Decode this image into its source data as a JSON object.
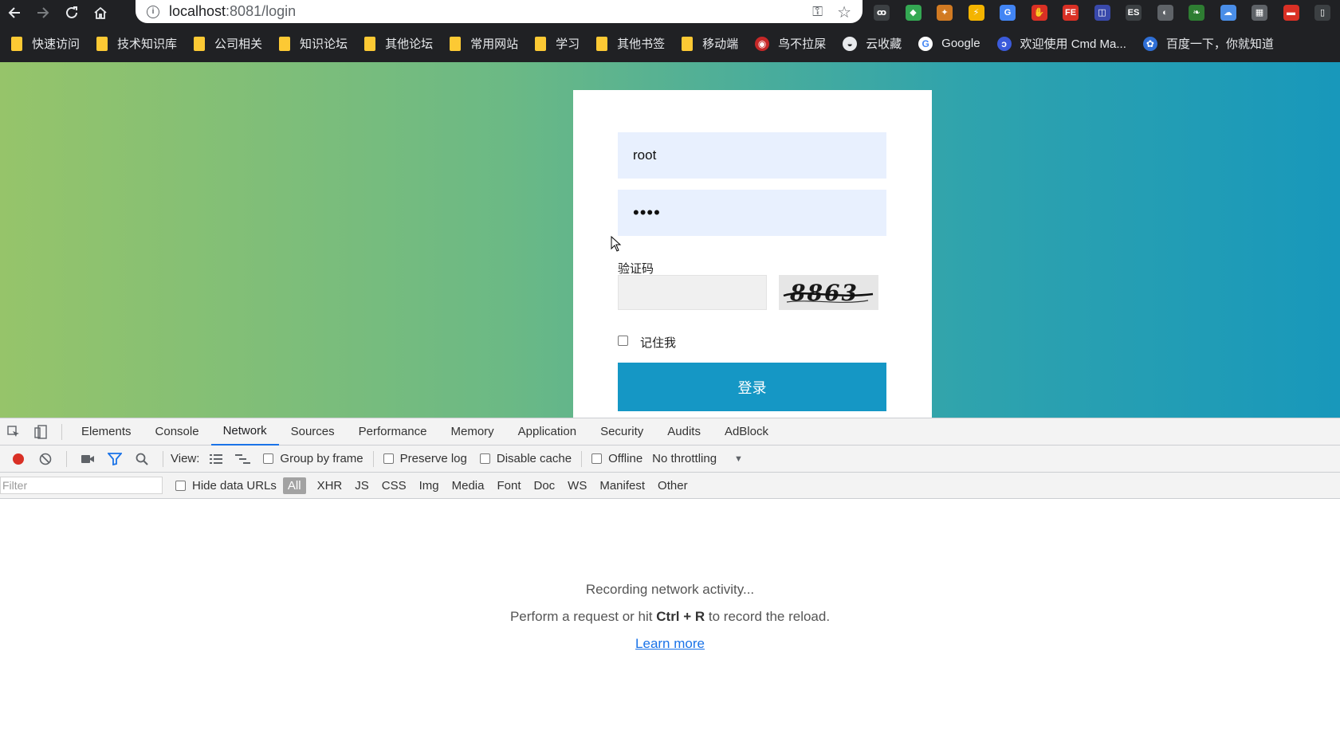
{
  "browser": {
    "url_host": "localhost",
    "url_port_path": ":8081/login",
    "extensions": [
      {
        "label": "ꝏ",
        "color": "#3c4043"
      },
      {
        "label": "◆",
        "color": "#34a853"
      },
      {
        "label": "✦",
        "color": "#d17a22"
      },
      {
        "label": "⚡",
        "color": "#f4b400"
      },
      {
        "label": "G",
        "color": "#4285f4"
      },
      {
        "label": "✋",
        "color": "#d93025"
      },
      {
        "label": "FE",
        "color": "#d93025"
      },
      {
        "label": "◫",
        "color": "#3949ab"
      },
      {
        "label": "ES",
        "color": "#3c4043"
      },
      {
        "label": "◐",
        "color": "#5f6368"
      },
      {
        "label": "❧",
        "color": "#2e7d32"
      },
      {
        "label": "☁",
        "color": "#4a8ee8"
      },
      {
        "label": "▦",
        "color": "#5f6368"
      },
      {
        "label": "▬",
        "color": "#d93025"
      },
      {
        "label": "▯",
        "color": "#3c4043"
      }
    ],
    "bookmarks": [
      {
        "label": "快速访问",
        "type": "folder"
      },
      {
        "label": "技术知识库",
        "type": "folder"
      },
      {
        "label": "公司相关",
        "type": "folder"
      },
      {
        "label": "知识论坛",
        "type": "folder"
      },
      {
        "label": "其他论坛",
        "type": "folder"
      },
      {
        "label": "常用网站",
        "type": "folder"
      },
      {
        "label": "学习",
        "type": "folder"
      },
      {
        "label": "其他书签",
        "type": "folder"
      },
      {
        "label": "移动端",
        "type": "folder"
      },
      {
        "label": "鸟不拉屎",
        "type": "site"
      },
      {
        "label": "云收藏",
        "type": "site"
      },
      {
        "label": "Google",
        "type": "site"
      },
      {
        "label": "欢迎使用 Cmd Ma...",
        "type": "site"
      },
      {
        "label": "百度一下，你就知道",
        "type": "site"
      }
    ]
  },
  "login": {
    "username_value": "root",
    "password_mask": "••••",
    "captcha_label": "验证码",
    "captcha_value": "",
    "captcha_text": "8863",
    "remember_label": "记住我",
    "submit_label": "登录"
  },
  "devtools": {
    "tabs": [
      "Elements",
      "Console",
      "Network",
      "Sources",
      "Performance",
      "Memory",
      "Application",
      "Security",
      "Audits",
      "AdBlock"
    ],
    "active_tab": "Network",
    "toolbar": {
      "view_label": "View:",
      "group_by_frame": "Group by frame",
      "preserve_log": "Preserve log",
      "disable_cache": "Disable cache",
      "offline": "Offline",
      "throttling": "No throttling"
    },
    "filter_placeholder": "Filter",
    "hide_data_urls": "Hide data URLs",
    "types": [
      "All",
      "XHR",
      "JS",
      "CSS",
      "Img",
      "Media",
      "Font",
      "Doc",
      "WS",
      "Manifest",
      "Other"
    ],
    "active_type": "All",
    "empty_state": {
      "line1": "Recording network activity...",
      "line2_prefix": "Perform a request or hit ",
      "line2_shortcut": "Ctrl + R",
      "line2_suffix": " to record the reload.",
      "link": "Learn more"
    }
  }
}
